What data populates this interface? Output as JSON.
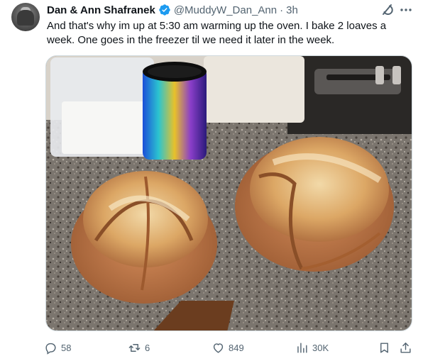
{
  "author": {
    "display_name": "Dan & Ann Shafranek",
    "handle": "@MuddyW_Dan_Ann",
    "separator": "·",
    "time": "3h"
  },
  "tweet": {
    "text": "And that's why im up at 5:30 am warming up the oven. I bake 2 loaves a week. One goes in the freezer til we need it later in the week."
  },
  "actions": {
    "replies": "58",
    "reposts": "6",
    "likes": "849",
    "views": "30K"
  },
  "colors": {
    "verified": "#1d9bf0",
    "text_primary": "#0f1419",
    "text_secondary": "#536471",
    "border": "#cfd9de"
  },
  "icons": {
    "verified": "verified-badge-icon",
    "grok": "grok-icon",
    "more": "more-dots-icon",
    "reply": "reply-icon",
    "repost": "repost-icon",
    "like": "heart-icon",
    "views": "views-chart-icon",
    "bookmark": "bookmark-icon",
    "share": "share-icon"
  }
}
